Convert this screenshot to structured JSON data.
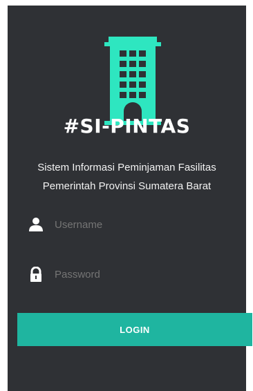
{
  "app": {
    "title": "#SI-PINTAS",
    "subtitle_line1": "Sistem Informasi Peminjaman Fasilitas",
    "subtitle_line2": "Pemerintah Provinsi Sumatera Barat",
    "logo_icon": "building-icon"
  },
  "form": {
    "username": {
      "placeholder": "Username",
      "value": "",
      "icon": "user-icon"
    },
    "password": {
      "placeholder": "Password",
      "value": "",
      "icon": "lock-icon"
    },
    "login_label": "LOGIN"
  },
  "colors": {
    "background": "#2f3135",
    "accent": "#1fb5a0",
    "text": "#ffffff"
  }
}
